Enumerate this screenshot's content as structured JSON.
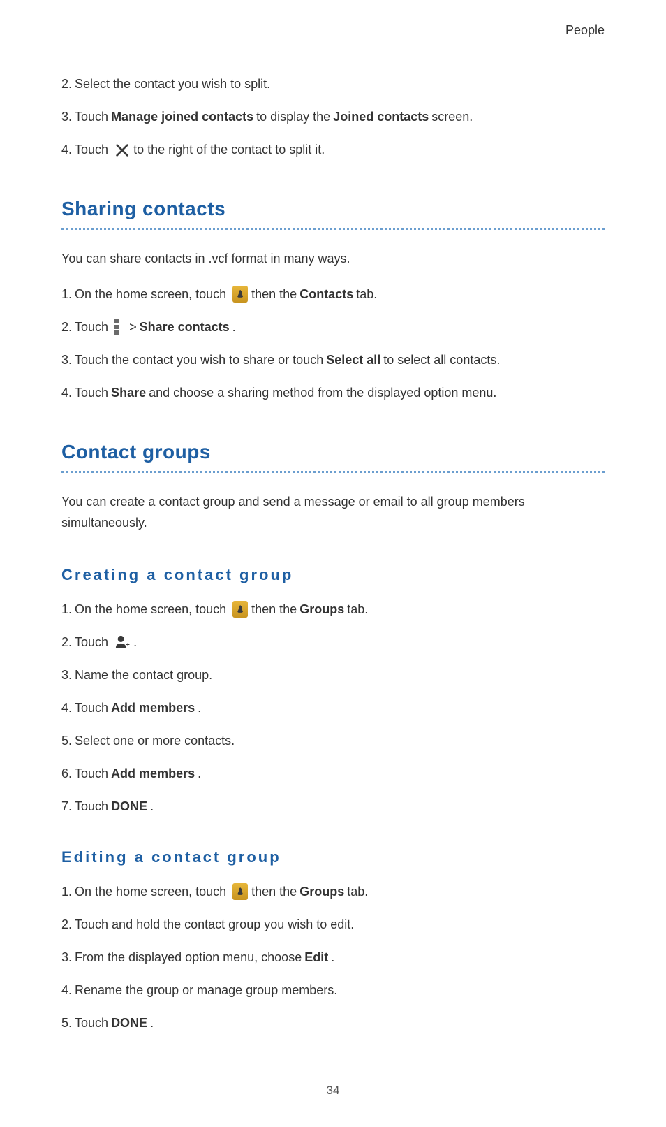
{
  "header": "People",
  "prelim": {
    "s2": {
      "num": "2.",
      "text": "Select the contact you wish to split."
    },
    "s3": {
      "num": "3.",
      "p1": "Touch ",
      "b1": "Manage joined contacts",
      "p2": " to display the ",
      "b2": "Joined contacts",
      "p3": " screen."
    },
    "s4": {
      "num": "4.",
      "p1": "Touch ",
      "p2": " to the right of the contact to split it."
    }
  },
  "sharing": {
    "heading": "Sharing contacts",
    "intro": "You can share contacts in .vcf format in many ways.",
    "s1": {
      "num": "1.",
      "p1": "On the home screen, touch ",
      "p2": " then the ",
      "b1": "Contacts",
      "p3": " tab."
    },
    "s2": {
      "num": "2.",
      "p1": "Touch ",
      "gt": ">",
      "b1": "Share contacts",
      "p2": "."
    },
    "s3": {
      "num": "3.",
      "p1": "Touch the contact you wish to share or touch ",
      "b1": "Select all",
      "p2": " to select all contacts."
    },
    "s4": {
      "num": "4.",
      "p1": "Touch ",
      "b1": "Share",
      "p2": " and choose a sharing method from the displayed option menu."
    }
  },
  "groups": {
    "heading": "Contact groups",
    "intro": "You can create a contact group and send a message or email to all group members simultaneously.",
    "create": {
      "heading": "Creating  a  contact  group",
      "s1": {
        "num": "1.",
        "p1": "On the home screen, touch ",
        "p2": " then the ",
        "b1": "Groups",
        "p3": " tab."
      },
      "s2": {
        "num": "2.",
        "p1": "Touch ",
        "p2": " ."
      },
      "s3": {
        "num": "3.",
        "text": "Name the contact group."
      },
      "s4": {
        "num": "4.",
        "p1": "Touch ",
        "b1": "Add members",
        "p2": "."
      },
      "s5": {
        "num": "5.",
        "text": "Select one or more contacts."
      },
      "s6": {
        "num": "6.",
        "p1": "Touch ",
        "b1": "Add members",
        "p2": "."
      },
      "s7": {
        "num": "7.",
        "p1": "Touch ",
        "b1": "DONE",
        "p2": "."
      }
    },
    "edit": {
      "heading": "Editing  a  contact  group",
      "s1": {
        "num": "1.",
        "p1": "On the home screen, touch ",
        "p2": " then the ",
        "b1": "Groups",
        "p3": " tab."
      },
      "s2": {
        "num": "2.",
        "text": "Touch and hold the contact group you wish to edit."
      },
      "s3": {
        "num": "3.",
        "p1": "From the displayed option menu, choose ",
        "b1": "Edit",
        "p2": "."
      },
      "s4": {
        "num": "4.",
        "text": "Rename the group or manage group members."
      },
      "s5": {
        "num": "5.",
        "p1": "Touch ",
        "b1": "DONE",
        "p2": "."
      }
    }
  },
  "page_number": "34"
}
